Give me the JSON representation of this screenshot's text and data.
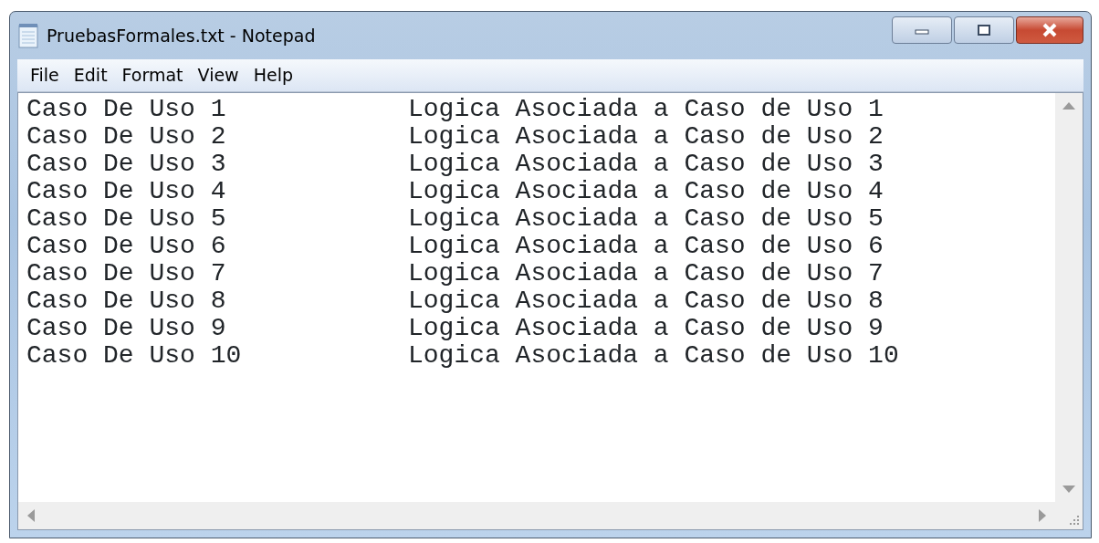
{
  "window": {
    "title": "PruebasFormales.txt - Notepad"
  },
  "menu": [
    "File",
    "Edit",
    "Format",
    "View",
    "Help"
  ],
  "lines": [
    {
      "use_case": "Caso De Uso 1",
      "logic": "Logica Asociada a Caso de Uso 1"
    },
    {
      "use_case": "Caso De Uso 2",
      "logic": "Logica Asociada a Caso de Uso 2"
    },
    {
      "use_case": "Caso De Uso 3",
      "logic": "Logica Asociada a Caso de Uso 3"
    },
    {
      "use_case": "Caso De Uso 4",
      "logic": "Logica Asociada a Caso de Uso 4"
    },
    {
      "use_case": "Caso De Uso 5",
      "logic": "Logica Asociada a Caso de Uso 5"
    },
    {
      "use_case": "Caso De Uso 6",
      "logic": "Logica Asociada a Caso de Uso 6"
    },
    {
      "use_case": "Caso De Uso 7",
      "logic": "Logica Asociada a Caso de Uso 7"
    },
    {
      "use_case": "Caso De Uso 8",
      "logic": "Logica Asociada a Caso de Uso 8"
    },
    {
      "use_case": "Caso De Uso 9",
      "logic": "Logica Asociada a Caso de Uso 9"
    },
    {
      "use_case": "Caso De Uso 10",
      "logic": "Logica Asociada a Caso de Uso 10"
    }
  ]
}
